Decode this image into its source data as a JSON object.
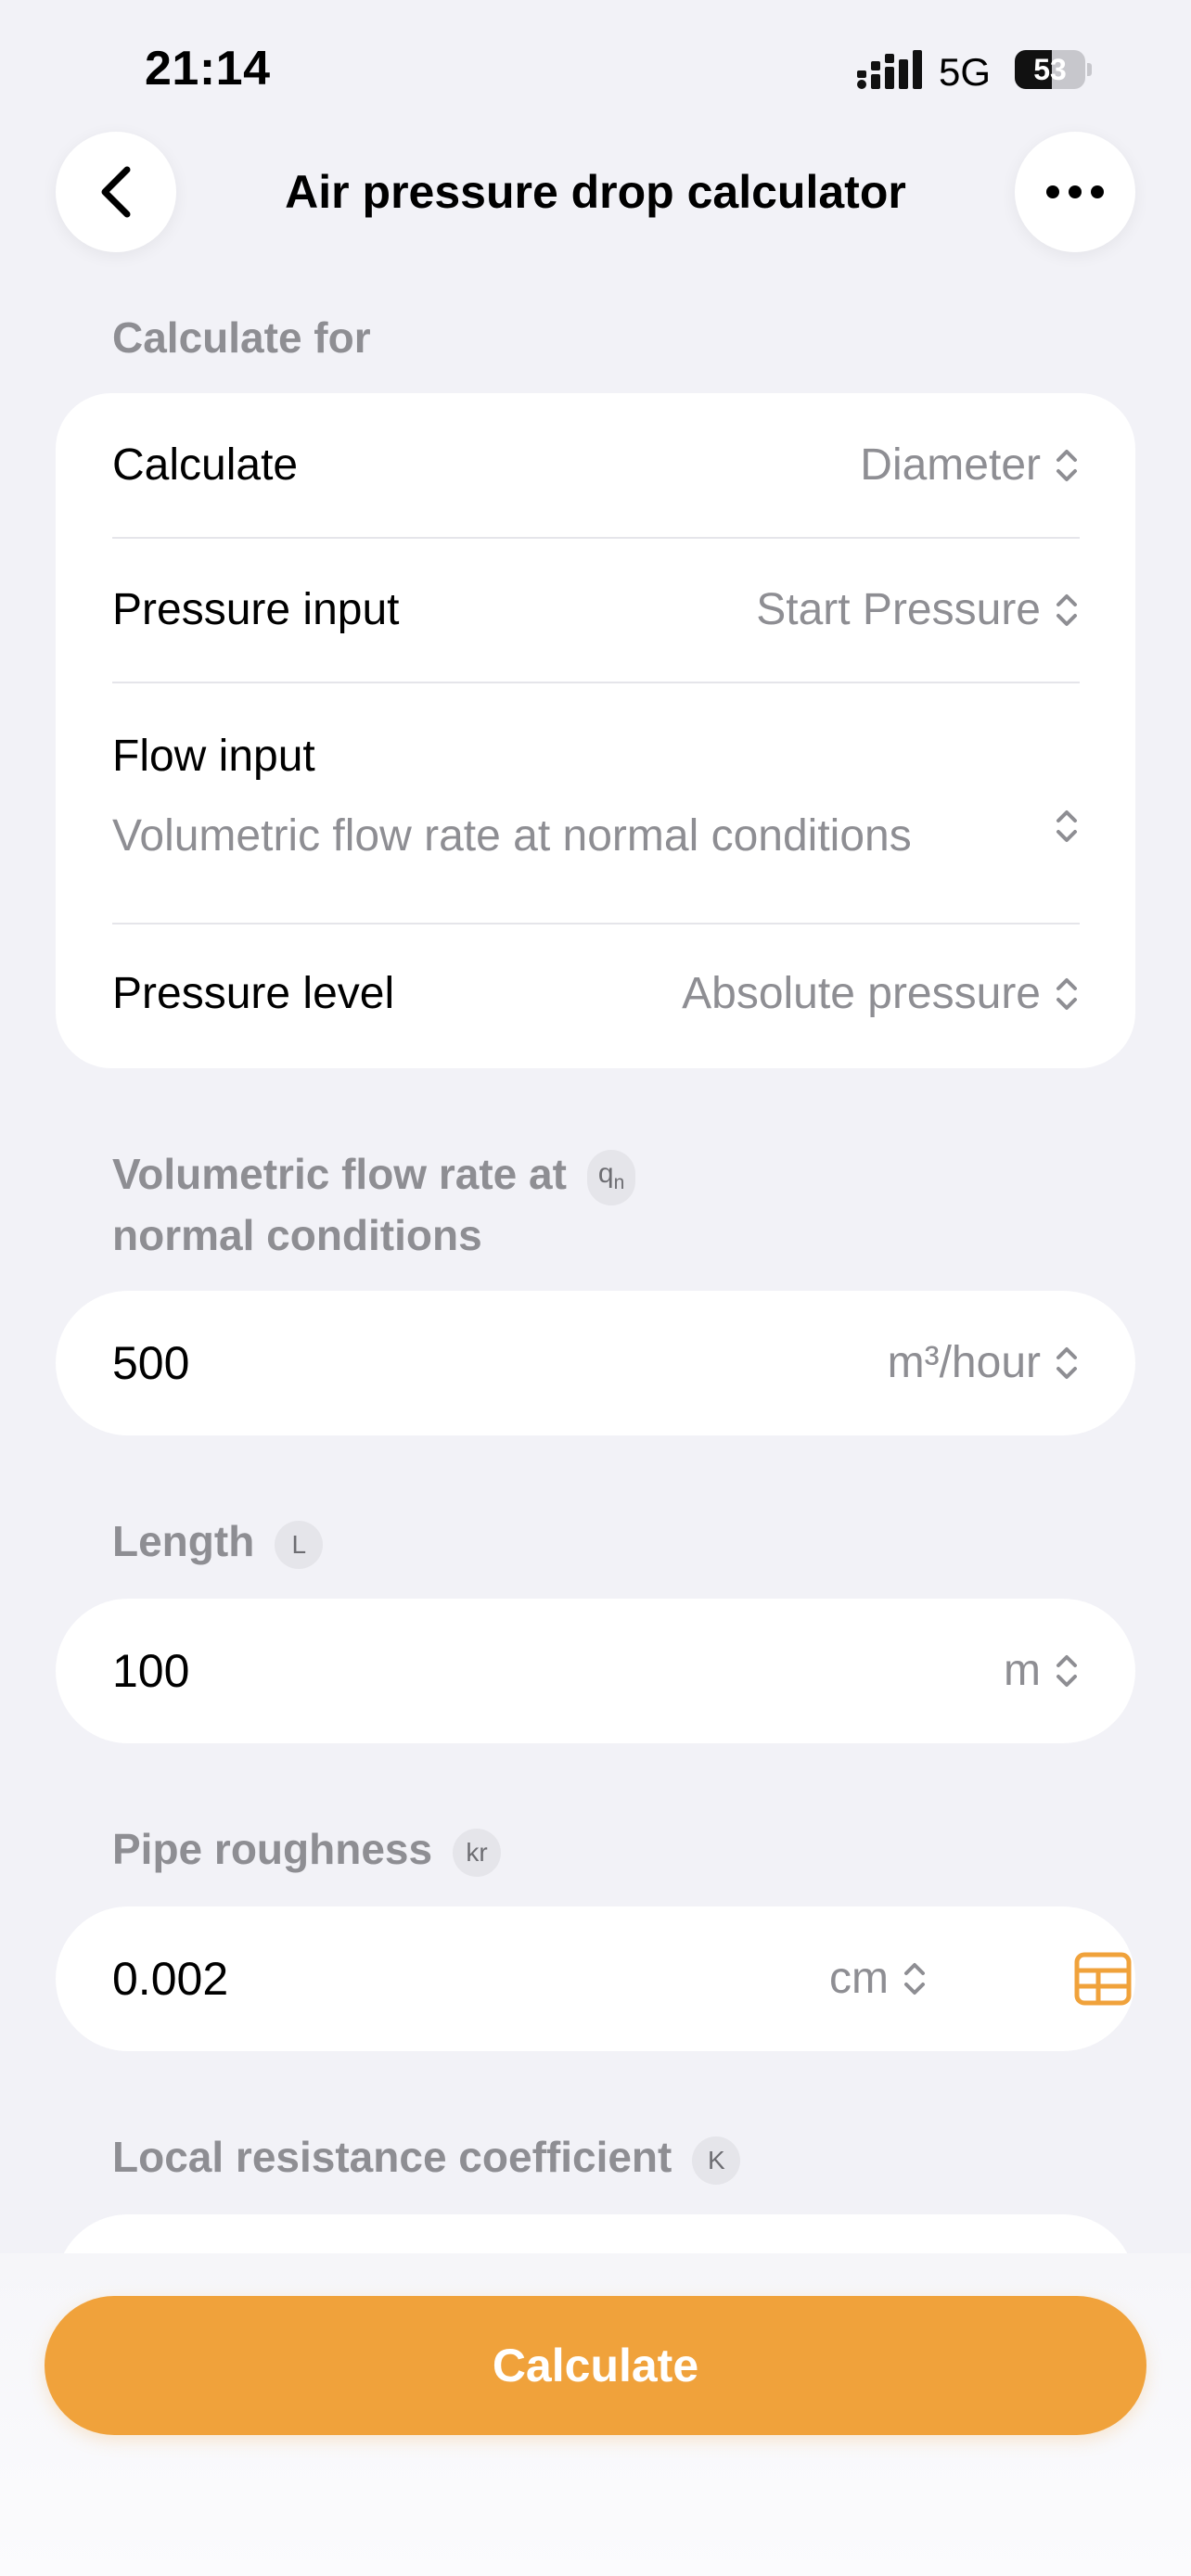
{
  "status_bar": {
    "time": "21:14",
    "network": "5G",
    "battery_level": "53",
    "battery_percent": 53
  },
  "nav": {
    "title": "Air pressure drop calculator"
  },
  "icons": {
    "back": "chevron-left-icon",
    "more": "ellipsis-icon",
    "selector": "chevron-up-down-icon",
    "table": "table-icon"
  },
  "colors": {
    "accent": "#f0a23b",
    "background": "#f2f2f7",
    "secondary_text": "#8e8e93"
  },
  "calculate_for": {
    "heading": "Calculate for",
    "rows": [
      {
        "label": "Calculate",
        "value": "Diameter"
      },
      {
        "label": "Pressure input",
        "value": "Start Pressure"
      },
      {
        "label": "Flow input",
        "value": "Volumetric flow rate at normal conditions"
      },
      {
        "label": "Pressure level",
        "value": "Absolute pressure"
      }
    ]
  },
  "fields": {
    "flow_rate": {
      "label_line1": "Volumetric flow rate at",
      "label_line2": "normal conditions",
      "tag_main": "q",
      "tag_sub": "n",
      "value": "500",
      "unit": "m³/hour"
    },
    "length": {
      "label": "Length",
      "tag": "L",
      "value": "100",
      "unit": "m"
    },
    "roughness": {
      "label": "Pipe roughness",
      "tag": "kr",
      "value": "0.002",
      "unit": "cm"
    },
    "local_resistance": {
      "label": "Local resistance coefficient",
      "tag": "K"
    }
  },
  "actions": {
    "calculate_label": "Calculate"
  }
}
